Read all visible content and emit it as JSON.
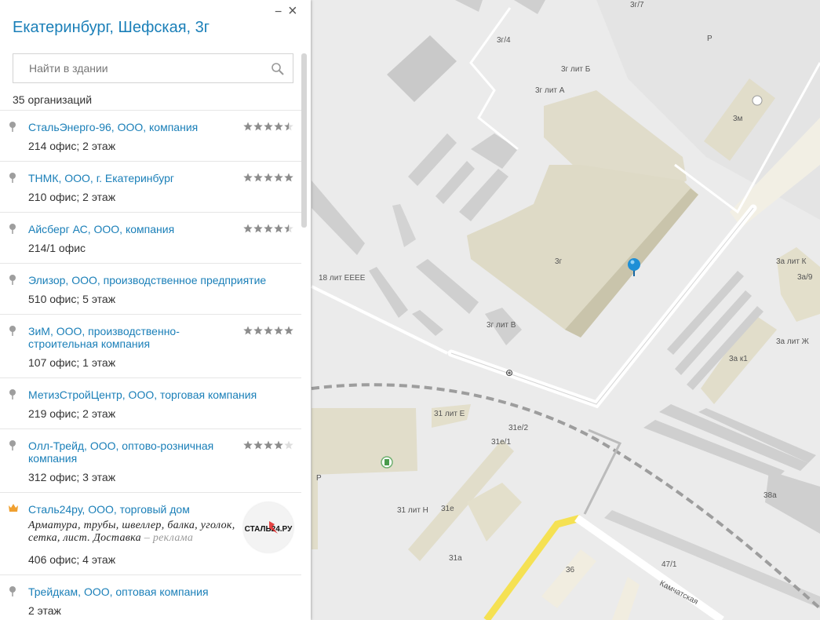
{
  "panel": {
    "title": "Екатеринбург, Шефская, 3г",
    "search_placeholder": "Найти в здании",
    "count": "35 организаций",
    "minimize_glyph": "−",
    "close_glyph": "×"
  },
  "organizations": [
    {
      "name": "СтальЭнерго-96, ООО, компания",
      "address": "214 офис; 2 этаж",
      "rating": 4.5
    },
    {
      "name": "ТНМК, ООО, г. Екатеринбург",
      "address": "210 офис; 2 этаж",
      "rating": 5
    },
    {
      "name": "Айсберг АС, ООО, компания",
      "address": "214/1 офис",
      "rating": 4.5
    },
    {
      "name": "Элизор, ООО, производственное предприятие",
      "address": "510 офис; 5 этаж",
      "rating": null
    },
    {
      "name": "ЗиМ, ООО, производственно-строительная компания",
      "address": "107 офис; 1 этаж",
      "rating": 5
    },
    {
      "name": "МетизСтройЦентр, ООО, торговая компания",
      "address": "219 офис; 2 этаж",
      "rating": null
    },
    {
      "name": "Олл-Трейд, ООО, оптово-розничная компания",
      "address": "312 офис; 3 этаж",
      "rating": 4
    },
    {
      "name": "Сталь24ру, ООО, торговый дом",
      "address": "406 офис; 4 этаж",
      "rating": null,
      "ad": "Арматура, трубы, швеллер, балка, уголок, сетка, лист. Доставка",
      "ad_tag": " – реклама",
      "logo": "СТАЛЬ24.РУ"
    },
    {
      "name": "Трейдкам, ООО, оптовая компания",
      "address": "2 этаж",
      "rating": null
    }
  ],
  "map": {
    "labels": [
      "3г/7",
      "3г/4",
      "3г лит Б",
      "3г лит А",
      "3м",
      "Р",
      "3г",
      "18 лит ЕЕЕЕ",
      "3г лит В",
      "3а лит К",
      "3а/9",
      "3а лит Ж",
      "3а к1",
      "31 лит Е",
      "31е/2",
      "31е/1",
      "31 лит Н",
      "31е",
      "31а",
      "36",
      "47/1",
      "38а",
      "Р",
      "Камчатская"
    ]
  },
  "colors": {
    "accent": "#1a7fb8",
    "star": "#8c8c8c",
    "crown": "#f0a030",
    "marker": "#1e8fd6"
  },
  "icons": {
    "search": "search-icon",
    "pin": "pin-icon",
    "crown": "crown-icon",
    "marker": "map-marker-icon"
  }
}
